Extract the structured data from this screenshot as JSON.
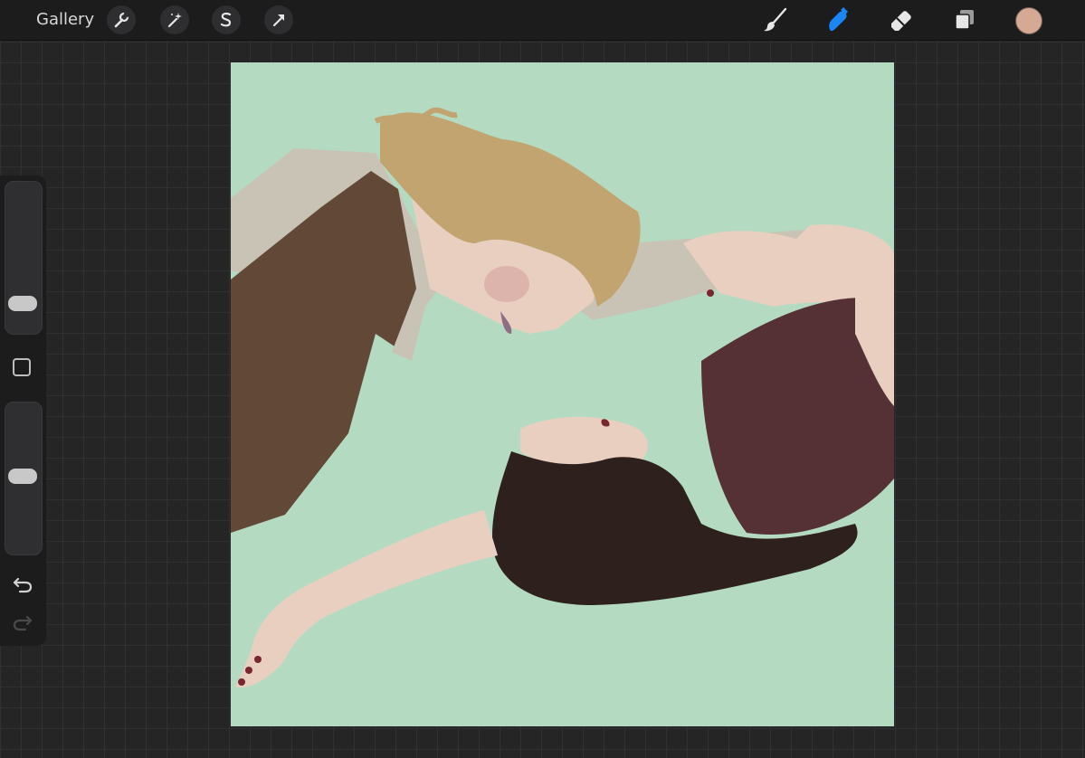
{
  "topbar": {
    "gallery_label": "Gallery",
    "actions_icon": "wrench-icon",
    "adjustments_icon": "magic-wand-icon",
    "selection_icon": "selection-s-icon",
    "transform_icon": "arrow-cursor-icon",
    "brush_icon": "paintbrush-icon",
    "smudge_icon": "smudge-finger-icon",
    "smudge_active_color": "#1a86f4",
    "eraser_icon": "eraser-icon",
    "layers_icon": "layers-icon",
    "current_color": "#d6a994"
  },
  "sidebar": {
    "brush_size_level": 0.15,
    "opacity_level": 0.52,
    "modify_icon": "square-modify-icon",
    "undo_icon": "undo-arrow-icon",
    "redo_icon": "redo-arrow-icon"
  },
  "canvas": {
    "background_color": "#b4dbc2"
  }
}
